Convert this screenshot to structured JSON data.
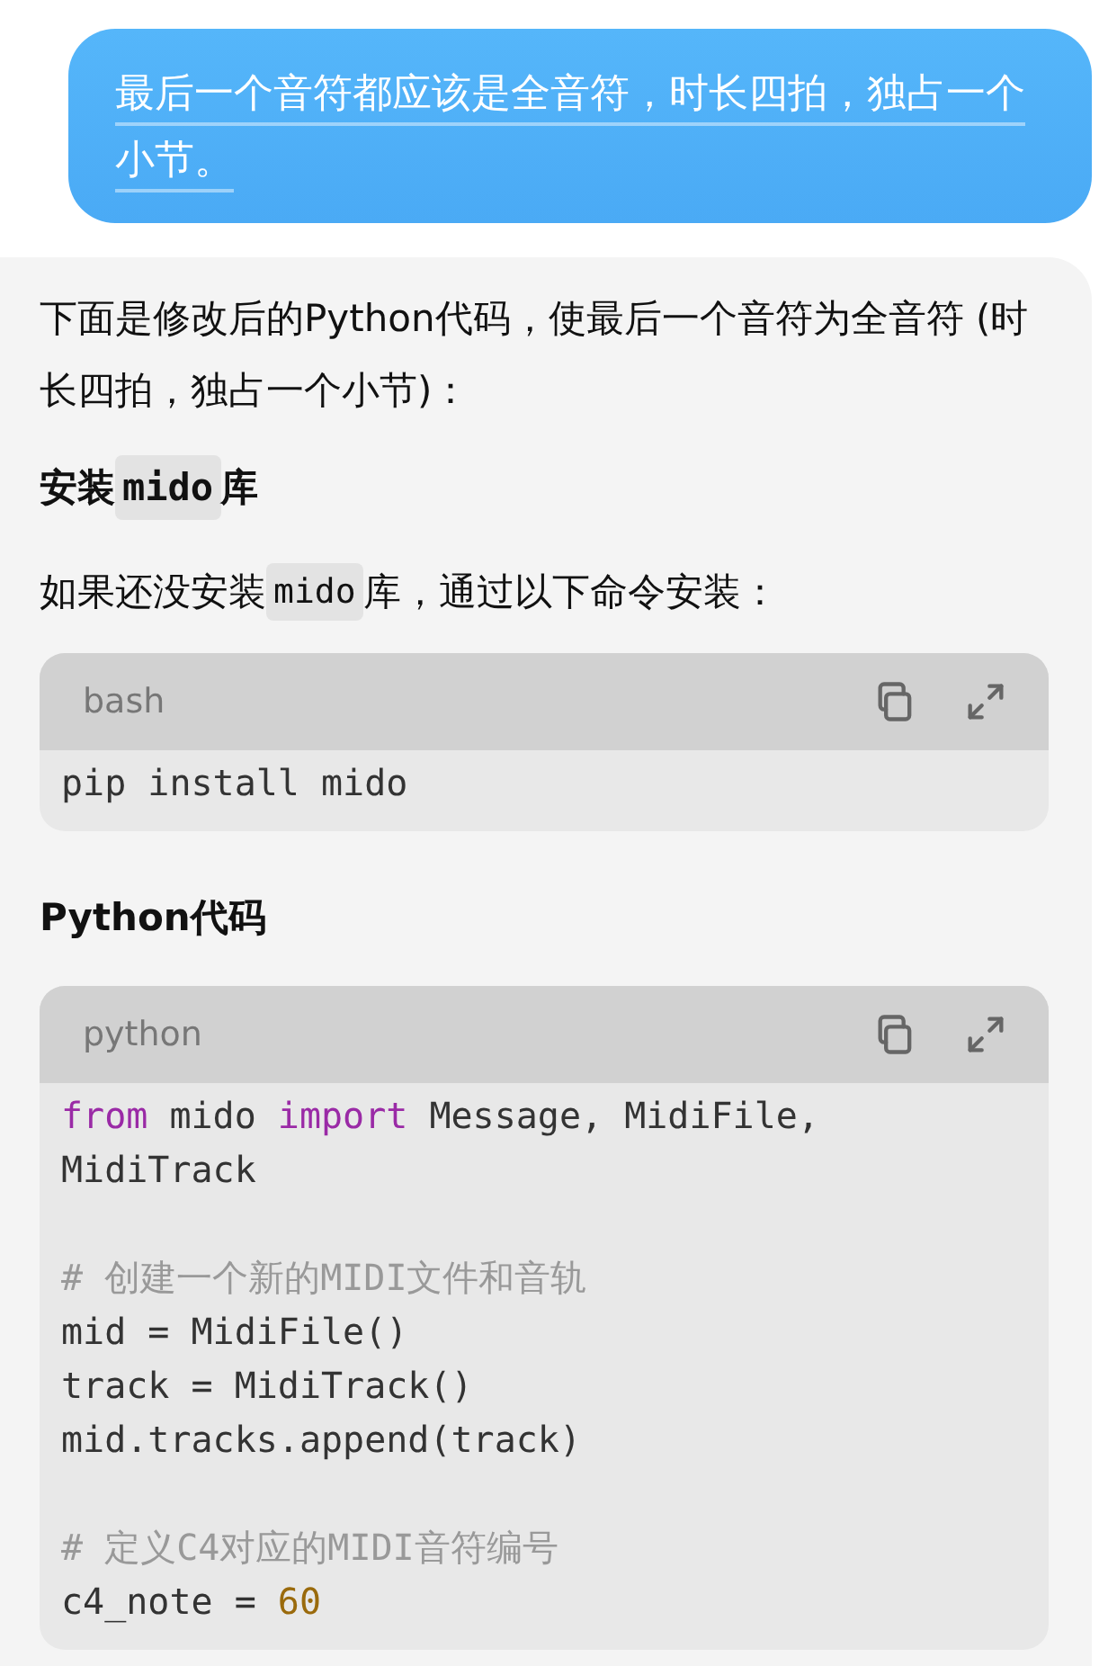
{
  "user_message": {
    "text": "最后一个音符都应该是全音符，时长四拍，独占一个小节。"
  },
  "reply": {
    "blocks": [
      {
        "kind": "paragraph",
        "segments": [
          {
            "kind": "text",
            "text": "下面是修改后的Python代码，使最后一个音符为全音符 (时长四拍，独占一个小节)："
          }
        ]
      },
      {
        "kind": "heading",
        "segments": [
          {
            "kind": "text",
            "text": "安装 "
          },
          {
            "kind": "code",
            "text": "mido"
          },
          {
            "kind": "text",
            "text": " 库"
          }
        ]
      },
      {
        "kind": "paragraph",
        "segments": [
          {
            "kind": "text",
            "text": "如果还没安装 "
          },
          {
            "kind": "code",
            "text": "mido"
          },
          {
            "kind": "text",
            "text": " 库，通过以下命令安装："
          }
        ]
      },
      {
        "kind": "codeblock",
        "language": "bash",
        "lines": [
          {
            "kind": "code",
            "tokens": [
              {
                "kind": "plain",
                "text": "pip install mido"
              }
            ]
          }
        ]
      },
      {
        "kind": "heading",
        "segments": [
          {
            "kind": "text",
            "text": "Python代码"
          }
        ]
      },
      {
        "kind": "codeblock",
        "language": "python",
        "lines": [
          {
            "kind": "code",
            "tokens": [
              {
                "kind": "keyword",
                "text": "from"
              },
              {
                "kind": "plain",
                "text": " mido "
              },
              {
                "kind": "keyword",
                "text": "import"
              },
              {
                "kind": "plain",
                "text": " Message, MidiFile, MidiTrack"
              }
            ]
          },
          {
            "kind": "blank"
          },
          {
            "kind": "code",
            "tokens": [
              {
                "kind": "comment",
                "text": "# 创建一个新的MIDI文件和音轨"
              }
            ]
          },
          {
            "kind": "code",
            "tokens": [
              {
                "kind": "plain",
                "text": "mid = MidiFile()"
              }
            ]
          },
          {
            "kind": "code",
            "tokens": [
              {
                "kind": "plain",
                "text": "track = MidiTrack()"
              }
            ]
          },
          {
            "kind": "code",
            "tokens": [
              {
                "kind": "plain",
                "text": "mid.tracks.append(track)"
              }
            ]
          },
          {
            "kind": "blank"
          },
          {
            "kind": "code",
            "tokens": [
              {
                "kind": "comment",
                "text": "# 定义C4对应的MIDI音符编号"
              }
            ]
          },
          {
            "kind": "code",
            "tokens": [
              {
                "kind": "plain",
                "text": "c4_note = "
              },
              {
                "kind": "number",
                "text": "60"
              }
            ]
          }
        ]
      }
    ]
  }
}
